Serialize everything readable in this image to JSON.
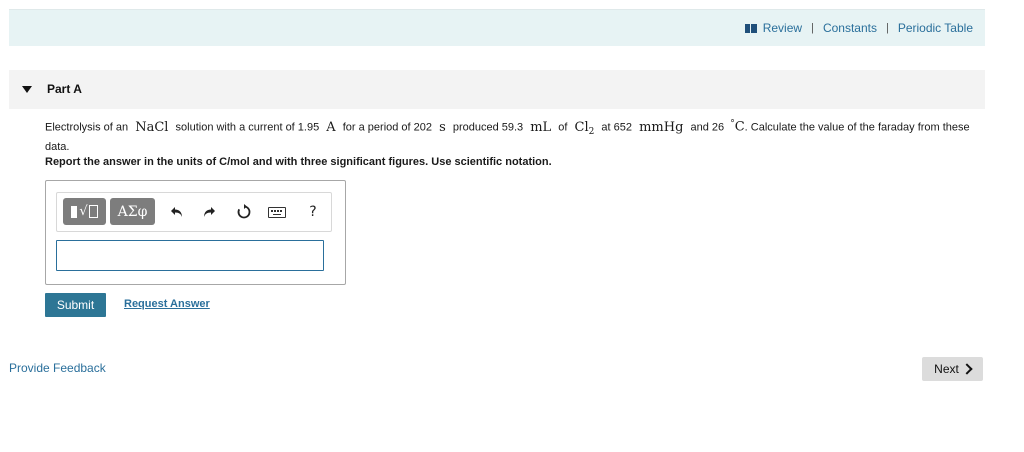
{
  "header": {
    "links": [
      "Review",
      "Constants",
      "Periodic Table"
    ]
  },
  "part": {
    "title": "Part A"
  },
  "question": {
    "t1": "Electrolysis of an",
    "m1": "NaCl",
    "t2": "solution with a current of 1.95",
    "m2": "A",
    "t3": "for a period of  202",
    "m3": "s",
    "t4": "produced   59.3",
    "m4": "mL",
    "t5": "of",
    "m5a": "Cl",
    "m5b": "2",
    "t6": "at  652",
    "m6": "mmHg",
    "t7": "and  26",
    "m7a": "°",
    "m7b": "C",
    "t8": ". Calculate the value of the faraday from these data."
  },
  "instructions": "Report the answer in the units of C/mol and with three significant figures. Use scientific notation.",
  "toolbar": {
    "templates_icon": "templates-icon",
    "greek_label": "ΑΣφ",
    "undo_icon": "undo-icon",
    "redo_icon": "redo-icon",
    "reset_icon": "reset-icon",
    "keyboard_icon": "keyboard-icon",
    "help_label": "?"
  },
  "answer": {
    "value": "",
    "placeholder": ""
  },
  "actions": {
    "submit_label": "Submit",
    "request_answer_label": "Request Answer",
    "feedback_label": "Provide Feedback",
    "next_label": "Next"
  },
  "colors": {
    "accent": "#2d7695",
    "link": "#2a6f9b",
    "banner": "#e7f3f4"
  }
}
